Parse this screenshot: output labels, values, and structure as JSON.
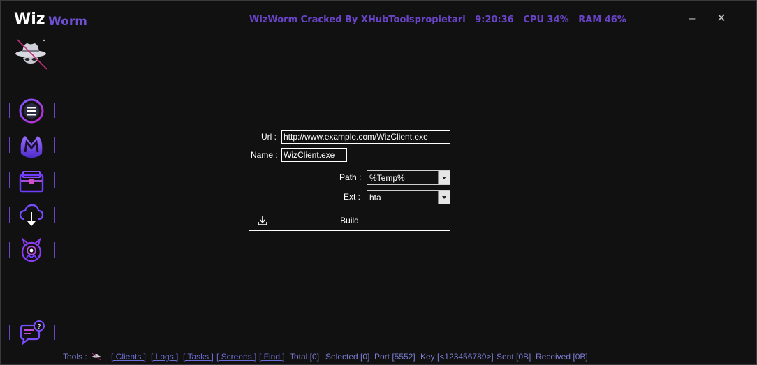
{
  "brand": {
    "wiz": "Wiz",
    "worm": "Worm"
  },
  "titlebar": {
    "title": "WizWorm Cracked By XHubToolspropietari",
    "time": "9:20:36",
    "cpu": "CPU 34%",
    "ram": "RAM 46%"
  },
  "window_controls": {
    "minimize": "–",
    "close": "✕"
  },
  "sidebar": {
    "items": [
      {
        "icon": "menu-icon"
      },
      {
        "icon": "malwarebytes-m-icon"
      },
      {
        "icon": "wallet-icon"
      },
      {
        "icon": "cloud-download-icon"
      },
      {
        "icon": "monster-eye-icon"
      },
      {
        "icon": "chat-help-icon"
      }
    ]
  },
  "form": {
    "url_label": "Url :",
    "url_value": "http://www.example.com/WizClient.exe",
    "name_label": "Name :",
    "name_value": "WizClient.exe",
    "path_label": "Path :",
    "path_value": "%Temp%",
    "ext_label": "Ext :",
    "ext_value": "hta",
    "build_label": "Build"
  },
  "status": {
    "tools": "Tools :",
    "clients": "[ Clients ]",
    "logs": "[ Logs ]",
    "tasks": "[ Tasks ]",
    "screens": "[ Screens ]",
    "find": "[ Find ]",
    "total": "Total [0]",
    "selected": "Selected [0]",
    "port": "Port [5552]",
    "key": "Key [<123456789>]",
    "sent": "Sent [0B]",
    "received": "Received [0B]"
  },
  "colors": {
    "accent": "#6a44c8",
    "background": "#111112",
    "status_text": "#7b7bd0"
  }
}
